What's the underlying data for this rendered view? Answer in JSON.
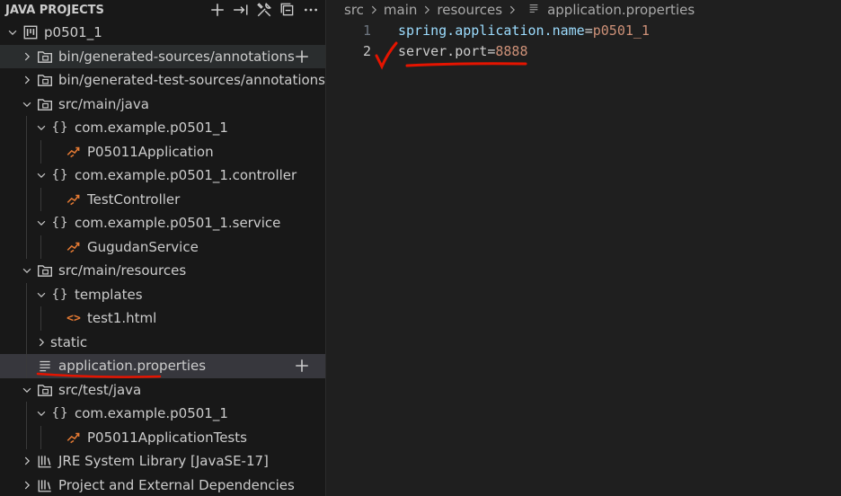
{
  "explorer": {
    "title": "JAVA PROJECTS",
    "actions": [
      {
        "icon": "plus-icon"
      },
      {
        "icon": "arrow-right-to-line-icon"
      },
      {
        "icon": "tools-icon"
      },
      {
        "icon": "collapse-all-icon"
      },
      {
        "icon": "ellipsis-icon"
      }
    ],
    "tree": [
      {
        "label": "p0501_1",
        "icon": "project-icon",
        "expanded": true,
        "indent": 0
      },
      {
        "label": "bin/generated-sources/annotations",
        "icon": "folder-package-icon",
        "expanded": false,
        "indent": 1,
        "hover": true,
        "action": "plus-icon"
      },
      {
        "label": "bin/generated-test-sources/annotations",
        "icon": "folder-package-icon",
        "expanded": false,
        "indent": 1
      },
      {
        "label": "src/main/java",
        "icon": "folder-package-icon",
        "expanded": true,
        "indent": 1
      },
      {
        "label": "com.example.p0501_1",
        "icon": "package-icon",
        "expanded": true,
        "indent": 2
      },
      {
        "label": "P05011Application",
        "icon": "java-class-icon",
        "indent": 3
      },
      {
        "label": "com.example.p0501_1.controller",
        "icon": "package-icon",
        "expanded": true,
        "indent": 2
      },
      {
        "label": "TestController",
        "icon": "java-class-icon",
        "indent": 3
      },
      {
        "label": "com.example.p0501_1.service",
        "icon": "package-icon",
        "expanded": true,
        "indent": 2
      },
      {
        "label": "GugudanService",
        "icon": "java-class-icon",
        "indent": 3
      },
      {
        "label": "src/main/resources",
        "icon": "folder-package-icon",
        "expanded": true,
        "indent": 1
      },
      {
        "label": "templates",
        "icon": "package-icon",
        "expanded": true,
        "indent": 2
      },
      {
        "label": "test1.html",
        "icon": "html-file-icon",
        "indent": 3
      },
      {
        "label": "static",
        "icon": "",
        "expanded": false,
        "indent": 2
      },
      {
        "label": "application.properties",
        "icon": "properties-file-icon",
        "indent": 2,
        "selected": true,
        "action": "plus-icon"
      },
      {
        "label": "src/test/java",
        "icon": "folder-package-icon",
        "expanded": true,
        "indent": 1
      },
      {
        "label": "com.example.p0501_1",
        "icon": "package-icon",
        "expanded": true,
        "indent": 2
      },
      {
        "label": "P05011ApplicationTests",
        "icon": "java-class-icon",
        "indent": 3
      },
      {
        "label": "JRE System Library [JavaSE-17]",
        "icon": "library-icon",
        "expanded": false,
        "indent": 1
      },
      {
        "label": "Project and External Dependencies",
        "icon": "library-icon",
        "expanded": false,
        "indent": 1
      }
    ]
  },
  "breadcrumb": {
    "parts": [
      "src",
      "main",
      "resources"
    ],
    "file": "application.properties"
  },
  "editor": {
    "lines": [
      {
        "num": "1",
        "key": "spring.application.name",
        "eq": "=",
        "value": "p0501_1"
      },
      {
        "num": "2",
        "key": "server.port",
        "eq": "=",
        "value": "8888"
      }
    ]
  },
  "colors": {
    "background": "#1f1f1f",
    "sidebar": "#181818",
    "selected": "#37373d",
    "annotation": "#e51400",
    "java_icon": "#e37933"
  }
}
